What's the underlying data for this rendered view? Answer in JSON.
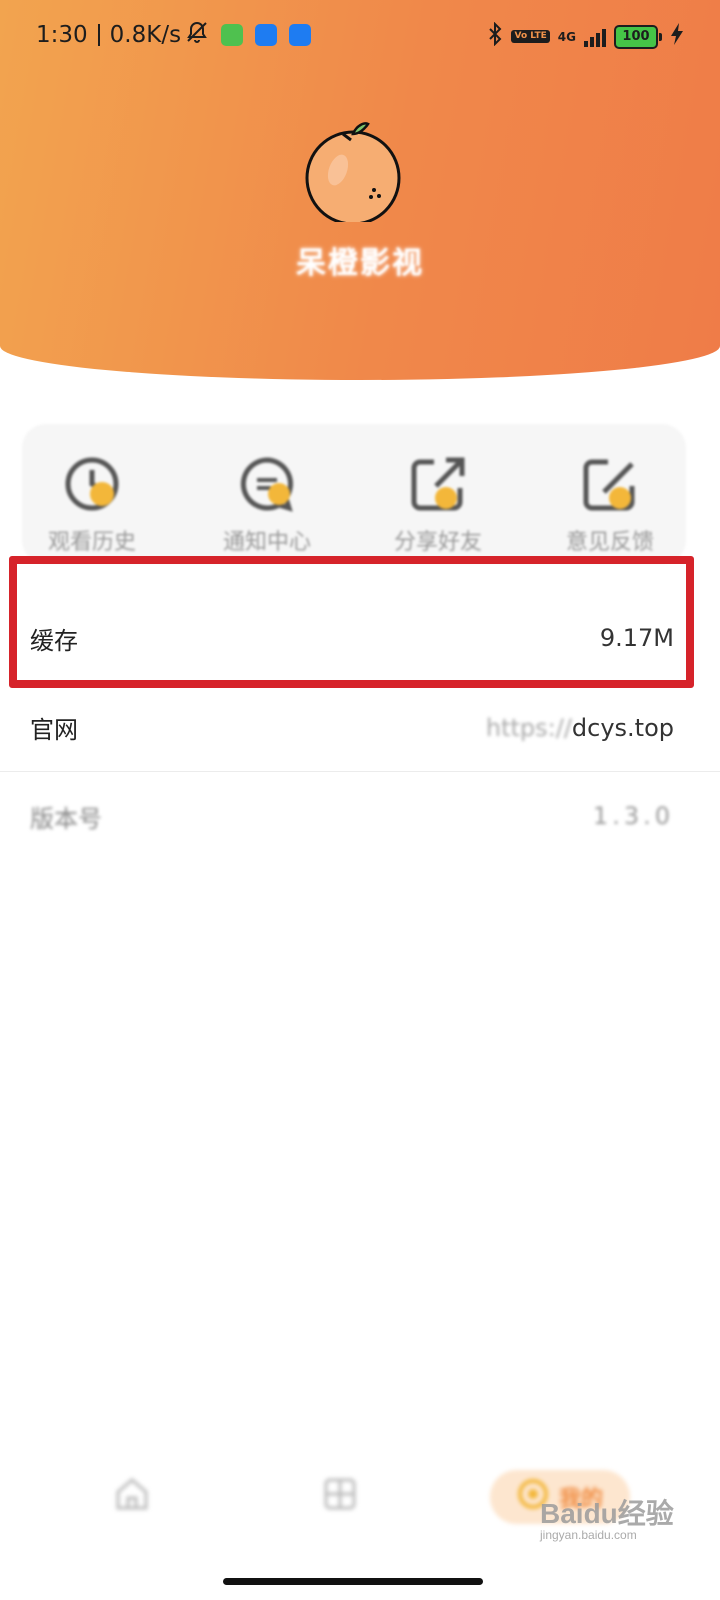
{
  "status_bar": {
    "time": "1:30",
    "speed": "0.8K/s",
    "network": "4G",
    "battery": "100",
    "volte": "Vo LTE"
  },
  "app": {
    "name": "呆橙影视"
  },
  "quick_actions": [
    {
      "label": "观看历史",
      "icon": "history-icon"
    },
    {
      "label": "通知中心",
      "icon": "message-icon"
    },
    {
      "label": "分享好友",
      "icon": "share-icon"
    },
    {
      "label": "意见反馈",
      "icon": "feedback-icon"
    }
  ],
  "settings": {
    "cache": {
      "label": "缓存",
      "value": "9.17M"
    },
    "website": {
      "label": "官网",
      "value_prefix": "https://",
      "value_main": "dcys.top"
    },
    "version": {
      "label": "版本号",
      "value": "1.3.0"
    }
  },
  "bottom_nav": {
    "mine_label": "我的"
  },
  "watermark": {
    "top": "Baidu经验",
    "bottom": "jingyan.baidu.com"
  },
  "colors": {
    "header_start": "#f2a44f",
    "header_end": "#ef7c48",
    "highlight": "#d6232a",
    "accent": "#f3b73a"
  }
}
